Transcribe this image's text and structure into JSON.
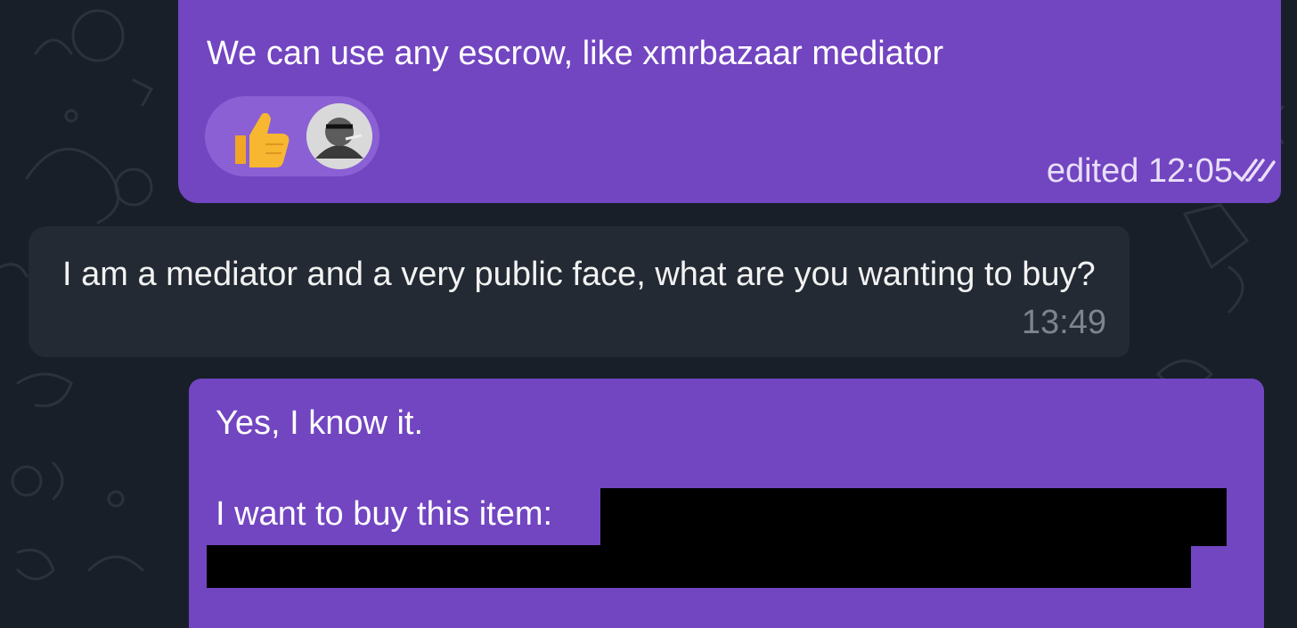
{
  "theme": {
    "chat_background": "#181f29",
    "outgoing_bubble": "#7245c1",
    "incoming_bubble": "#232a34",
    "reaction_pill": "#8a60d4",
    "thumbs_color": "#f7b731"
  },
  "messages": [
    {
      "direction": "outgoing",
      "text": "We can use any escrow, like xmrbazaar mediator",
      "reactions": [
        {
          "icon": "thumbs-up-icon"
        },
        {
          "icon": "reactor-avatar"
        }
      ],
      "meta": "edited 12:05",
      "status_icon": "double-check-icon"
    },
    {
      "direction": "incoming",
      "text": "I am a mediator and a very public face, what are you wanting to buy?",
      "time": "13:49"
    },
    {
      "direction": "outgoing",
      "line1": "Yes, I know it.",
      "line2": "I want to buy this item:",
      "redacted": true
    }
  ]
}
